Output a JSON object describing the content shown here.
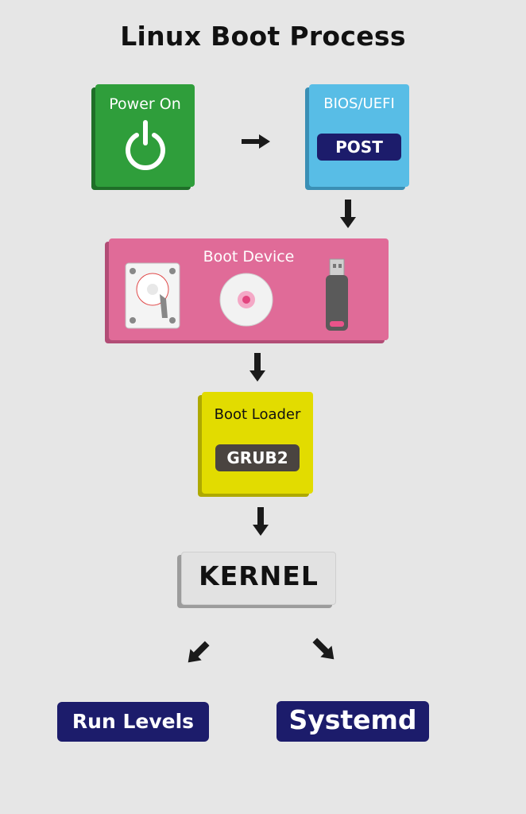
{
  "title": "Linux Boot Process",
  "power_on": {
    "label": "Power On",
    "icon": "power-icon",
    "color": "#2f9e3b"
  },
  "bios": {
    "label": "BIOS/UEFI",
    "badge": "POST",
    "color": "#58bde6"
  },
  "boot_device": {
    "label": "Boot Device",
    "icons": [
      "hard-disk-icon",
      "optical-disc-icon",
      "usb-drive-icon"
    ],
    "color": "#e06b98"
  },
  "boot_loader": {
    "label": "Boot Loader",
    "badge": "GRUB2",
    "color": "#e2dc00"
  },
  "kernel": {
    "label": "KERNEL"
  },
  "outputs": {
    "run_levels": "Run Levels",
    "systemd": "Systemd",
    "color": "#1c1c6b"
  }
}
